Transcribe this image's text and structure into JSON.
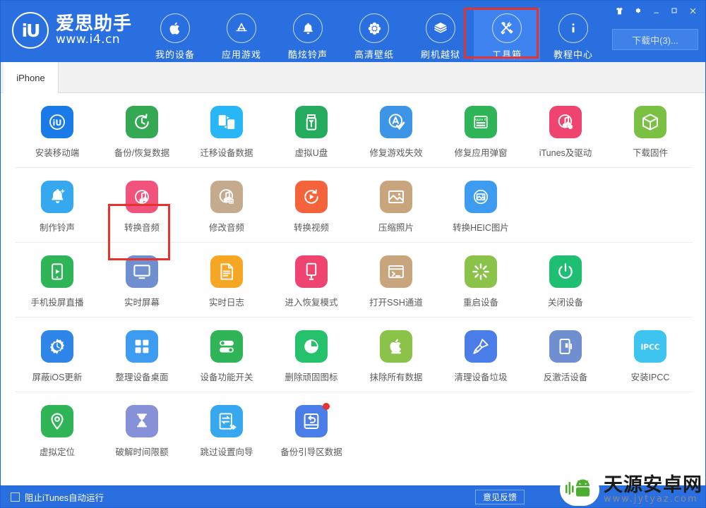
{
  "window": {
    "controls": [
      {
        "name": "skin-icon",
        "label": "皮肤"
      },
      {
        "name": "settings-gear-icon",
        "label": "设置"
      },
      {
        "name": "minimize-icon",
        "label": "最小化"
      },
      {
        "name": "maximize-icon",
        "label": "最大化"
      },
      {
        "name": "close-icon",
        "label": "关闭"
      }
    ]
  },
  "brand": {
    "mark": "iU",
    "title": "爱思助手",
    "url": "www.i4.cn"
  },
  "header": {
    "nav": [
      {
        "label": "我的设备",
        "icon": "apple-icon",
        "active": false
      },
      {
        "label": "应用游戏",
        "icon": "appstore-icon",
        "active": false
      },
      {
        "label": "酷炫铃声",
        "icon": "bell-icon",
        "active": false
      },
      {
        "label": "高清壁纸",
        "icon": "flower-icon",
        "active": false
      },
      {
        "label": "刷机越狱",
        "icon": "box-open-icon",
        "active": false
      },
      {
        "label": "工具箱",
        "icon": "tools-icon",
        "active": true
      },
      {
        "label": "教程中心",
        "icon": "info-icon",
        "active": false
      }
    ],
    "download_button": "下载中(3)...",
    "accent": "#2a6fe0",
    "highlight_color": "#e8322c"
  },
  "tabs": [
    {
      "label": "iPhone",
      "active": true
    }
  ],
  "toolbox": {
    "rows": [
      {
        "tiles": [
          {
            "label": "安装移动端",
            "icon": "i4-app-icon",
            "color": "#1a7ae8",
            "highlight": false,
            "badge": false
          },
          {
            "label": "备份/恢复数据",
            "icon": "backup-restore-icon",
            "color": "#34a853",
            "highlight": true,
            "badge": false
          },
          {
            "label": "迁移设备数据",
            "icon": "migrate-device-icon",
            "color": "#29b6f6",
            "highlight": false,
            "badge": false
          },
          {
            "label": "虚拟U盘",
            "icon": "usb-drive-icon",
            "color": "#25ab5e",
            "highlight": false,
            "badge": false
          },
          {
            "label": "修复游戏失效",
            "icon": "fix-game-icon",
            "color": "#3d95e8",
            "highlight": false,
            "badge": false
          },
          {
            "label": "修复应用弹窗",
            "icon": "appleid-popup-icon",
            "color": "#2fb457",
            "highlight": false,
            "badge": false
          },
          {
            "label": "iTunes及驱动",
            "icon": "itunes-driver-icon",
            "color": "#ef4470",
            "highlight": false,
            "badge": false
          },
          {
            "label": "下载固件",
            "icon": "firmware-box-icon",
            "color": "#7ac143",
            "highlight": false,
            "badge": false
          }
        ]
      },
      {
        "tiles": [
          {
            "label": "制作铃声",
            "icon": "make-ringtone-icon",
            "color": "#35a8f0",
            "highlight": false,
            "badge": false
          },
          {
            "label": "转换音频",
            "icon": "convert-audio-icon",
            "color": "#f2537d",
            "highlight": false,
            "badge": false
          },
          {
            "label": "修改音频",
            "icon": "edit-audio-icon",
            "color": "#c4ab8e",
            "highlight": false,
            "badge": false
          },
          {
            "label": "转换视频",
            "icon": "convert-video-icon",
            "color": "#f4633a",
            "highlight": false,
            "badge": false
          },
          {
            "label": "压缩照片",
            "icon": "compress-photo-icon",
            "color": "#c9a57e",
            "highlight": false,
            "badge": false
          },
          {
            "label": "转换HEIC图片",
            "icon": "convert-heic-icon",
            "color": "#3d9bf0",
            "highlight": false,
            "badge": false
          }
        ]
      },
      {
        "tiles": [
          {
            "label": "手机投屏直播",
            "icon": "screen-cast-icon",
            "color": "#2fb457",
            "highlight": false,
            "badge": false
          },
          {
            "label": "实时屏幕",
            "icon": "live-screen-icon",
            "color": "#6f8fd0",
            "highlight": false,
            "badge": false
          },
          {
            "label": "实时日志",
            "icon": "live-log-icon",
            "color": "#f5a623",
            "highlight": false,
            "badge": false
          },
          {
            "label": "进入恢复模式",
            "icon": "recovery-mode-icon",
            "color": "#ef4470",
            "highlight": false,
            "badge": false
          },
          {
            "label": "打开SSH通道",
            "icon": "ssh-tunnel-icon",
            "color": "#c9a57e",
            "highlight": false,
            "badge": false
          },
          {
            "label": "重启设备",
            "icon": "reboot-device-icon",
            "color": "#8bc34a",
            "highlight": false,
            "badge": false
          },
          {
            "label": "关闭设备",
            "icon": "shutdown-device-icon",
            "color": "#1fbf73",
            "highlight": false,
            "badge": false
          }
        ]
      },
      {
        "tiles": [
          {
            "label": "屏蔽iOS更新",
            "icon": "block-ios-update-icon",
            "color": "#2f86e8",
            "highlight": false,
            "badge": false
          },
          {
            "label": "整理设备桌面",
            "icon": "organize-desktop-icon",
            "color": "#3d9bf0",
            "highlight": false,
            "badge": false
          },
          {
            "label": "设备功能开关",
            "icon": "feature-toggle-icon",
            "color": "#2fb457",
            "highlight": false,
            "badge": false
          },
          {
            "label": "删除顽固图标",
            "icon": "remove-icon-icon",
            "color": "#25c16b",
            "highlight": false,
            "badge": false
          },
          {
            "label": "抹除所有数据",
            "icon": "erase-all-icon",
            "color": "#8bc34a",
            "highlight": false,
            "badge": false
          },
          {
            "label": "清理设备垃圾",
            "icon": "clean-junk-icon",
            "color": "#4a7de8",
            "highlight": false,
            "badge": false
          },
          {
            "label": "反激活设备",
            "icon": "deactivate-device-icon",
            "color": "#6f8fd0",
            "highlight": false,
            "badge": false
          },
          {
            "label": "安装IPCC",
            "icon": "install-ipcc-icon",
            "color": "#3dc5ef",
            "highlight": false,
            "badge": false
          }
        ]
      },
      {
        "tiles": [
          {
            "label": "虚拟定位",
            "icon": "virtual-location-icon",
            "color": "#2fb457",
            "highlight": false,
            "badge": false
          },
          {
            "label": "破解时间限额",
            "icon": "crack-timelimit-icon",
            "color": "#8691d8",
            "highlight": false,
            "badge": false
          },
          {
            "label": "跳过设置向导",
            "icon": "skip-setup-icon",
            "color": "#35a8f0",
            "highlight": false,
            "badge": false
          },
          {
            "label": "备份引导区数据",
            "icon": "backup-boot-icon",
            "color": "#4a7de8",
            "highlight": false,
            "badge": true
          }
        ]
      }
    ]
  },
  "footer": {
    "checkbox_label": "阻止iTunes自动运行",
    "checkbox_checked": false,
    "feedback_button": "意见反馈"
  },
  "watermark": {
    "title": "天源安卓网",
    "url": "www.jytyaz.com"
  }
}
